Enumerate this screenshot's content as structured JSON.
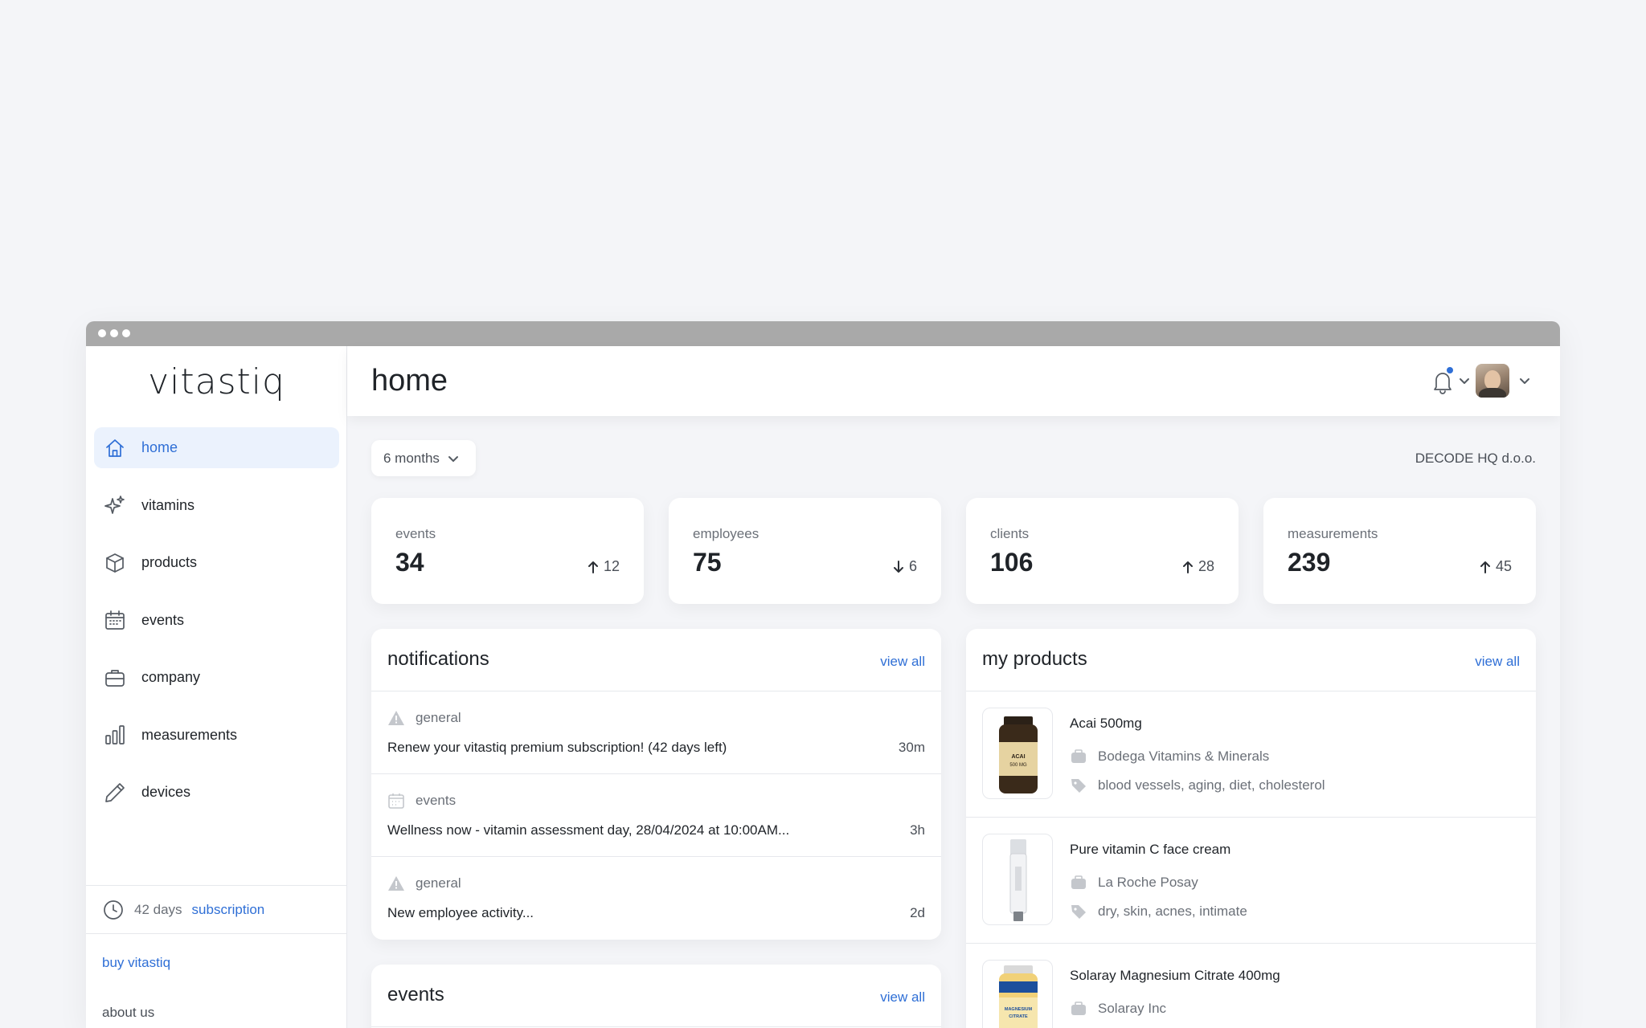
{
  "app": {
    "logo": "vitastiq",
    "page_title": "home"
  },
  "sidebar": {
    "items": [
      {
        "label": "home",
        "icon": "home-icon",
        "active": true
      },
      {
        "label": "vitamins",
        "icon": "sparkle-icon"
      },
      {
        "label": "products",
        "icon": "box-icon"
      },
      {
        "label": "events",
        "icon": "calendar-icon"
      },
      {
        "label": "company",
        "icon": "briefcase-icon"
      },
      {
        "label": "measurements",
        "icon": "bar-chart-icon"
      },
      {
        "label": "devices",
        "icon": "pencil-icon"
      }
    ],
    "subscription": {
      "days": "42 days",
      "link": "subscription"
    },
    "buy_link": "buy vitastiq",
    "about_link": "about us"
  },
  "header": {
    "notifications_icon": "bell-icon",
    "has_unread": true
  },
  "filters": {
    "period": "6 months",
    "company": "DECODE HQ d.o.o."
  },
  "stats": [
    {
      "label": "events",
      "value": "34",
      "delta": "12",
      "direction": "up"
    },
    {
      "label": "employees",
      "value": "75",
      "delta": "6",
      "direction": "down"
    },
    {
      "label": "clients",
      "value": "106",
      "delta": "28",
      "direction": "up"
    },
    {
      "label": "measurements",
      "value": "239",
      "delta": "45",
      "direction": "up"
    }
  ],
  "notifications": {
    "title": "notifications",
    "view_all": "view all",
    "items": [
      {
        "category": "general",
        "icon": "warning-icon",
        "text": "Renew your vitastiq premium subscription! (42 days left)",
        "time": "30m"
      },
      {
        "category": "events",
        "icon": "calendar-icon",
        "text": "Wellness now - vitamin assessment day, 28/04/2024 at 10:00AM...",
        "time": "3h"
      },
      {
        "category": "general",
        "icon": "warning-icon",
        "text": "New employee activity...",
        "time": "2d"
      }
    ]
  },
  "events_card": {
    "title": "events",
    "view_all": "view all"
  },
  "products": {
    "title": "my products",
    "view_all": "view all",
    "items": [
      {
        "name": "Acai 500mg",
        "brand": "Bodega Vitamins & Minerals",
        "tags": "blood vessels, aging, diet, cholesterol",
        "label_text": "ACAI 500 MG"
      },
      {
        "name": "Pure vitamin C face cream",
        "brand": "La Roche Posay",
        "tags": "dry, skin, acnes, intimate"
      },
      {
        "name": "Solaray Magnesium Citrate 400mg",
        "brand": "Solaray Inc",
        "tags": "",
        "label_text": "MAGNESIUM CITRATE"
      }
    ]
  },
  "colors": {
    "accent": "#2f6fd6",
    "active_bg": "#ebf2fd",
    "background": "#f4f5f8"
  }
}
